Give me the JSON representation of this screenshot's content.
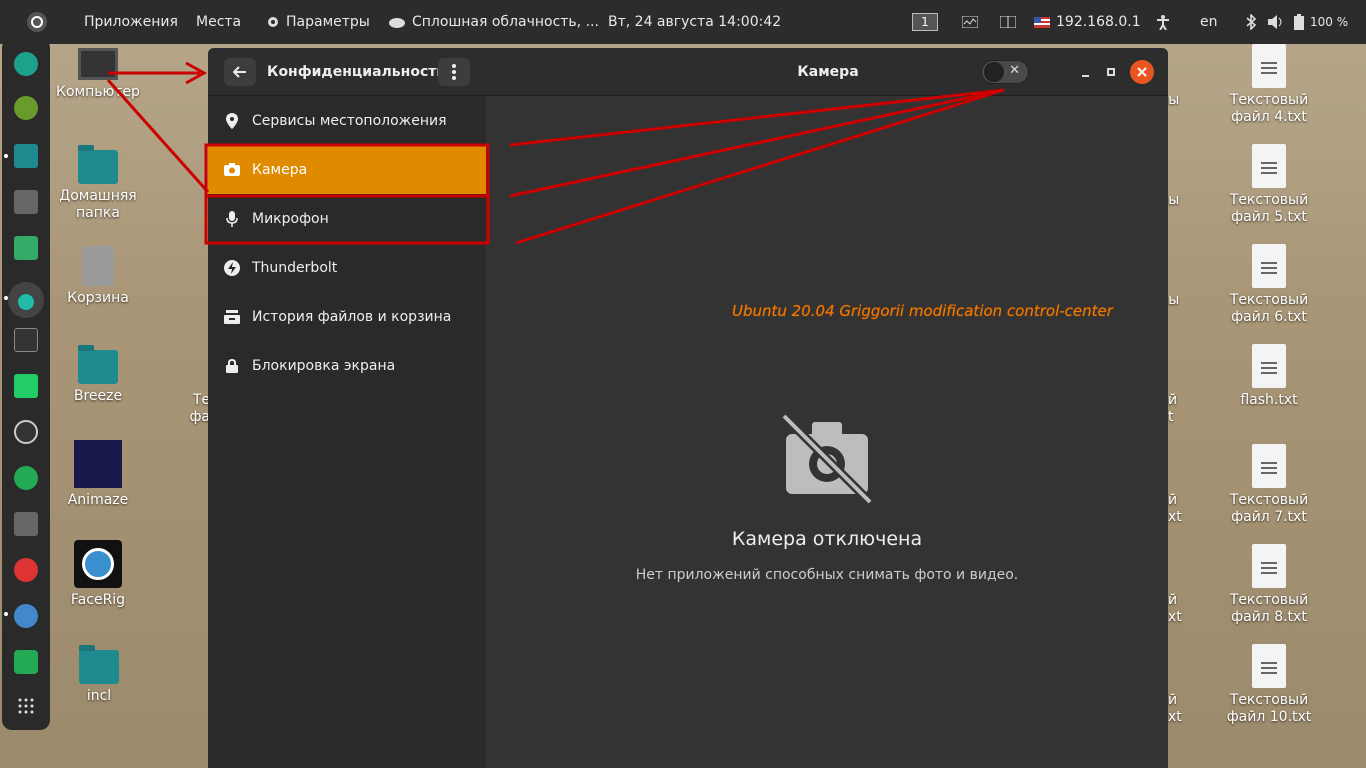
{
  "topbar": {
    "apps": "Приложения",
    "places": "Места",
    "settings": "Параметры",
    "weather": "Сплошная облачность, ...",
    "datetime": "Вт, 24 августа  14:00:42",
    "workspace": "1",
    "ip": "192.168.0.1",
    "lang": "en",
    "battery": "100 %"
  },
  "desktop": {
    "left": [
      "Компьютер",
      "Домашняя папка",
      "Корзина",
      "Breeze",
      "Animaze",
      "FaceRig",
      "incl"
    ],
    "right": [
      "Текстовый файл 4.txt",
      "Текстовый файл 5.txt",
      "Текстовый файл 6.txt",
      "flash.txt",
      "Текстовый файл 7.txt",
      "Текстовый файл 8.txt",
      "Текстовый файл 10.txt"
    ],
    "partial_right": [
      "нны",
      "xt",
      "нны",
      "xt",
      "нны",
      "xt",
      "й",
      "t",
      "й",
      "xt",
      "й",
      "xt",
      "й",
      "xt"
    ],
    "partial_left": [
      "Те",
      "фа"
    ]
  },
  "window": {
    "section_title": "Конфиденциальность",
    "page_title": "Камера",
    "sidebar": [
      {
        "label": "Сервисы местоположения",
        "icon": "location-pin-icon"
      },
      {
        "label": "Камера",
        "icon": "camera-icon"
      },
      {
        "label": "Микрофон",
        "icon": "microphone-icon"
      },
      {
        "label": "Thunderbolt",
        "icon": "thunderbolt-icon"
      },
      {
        "label": "История файлов и корзина",
        "icon": "file-history-icon"
      },
      {
        "label": "Блокировка экрана",
        "icon": "lock-icon"
      }
    ],
    "active_index": 1,
    "toggle_state": "off",
    "overlay_text": "Ubuntu 20.04 Griggorii modification control-center",
    "empty_title": "Камера отключена",
    "empty_subtitle": "Нет приложений способных снимать фото и видео."
  },
  "colors": {
    "accent": "#e08a00",
    "close": "#e95420",
    "annotation": "#cc0000",
    "overlay_text": "#f07a00"
  }
}
